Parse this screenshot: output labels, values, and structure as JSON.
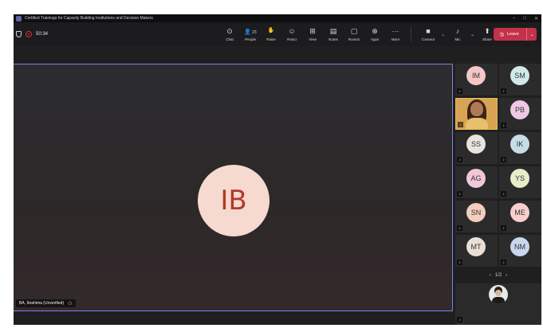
{
  "window": {
    "title": "Certified Trainings for Capacity Building Institutions and Decision Makers",
    "controls": [
      "–",
      "□",
      "✕"
    ]
  },
  "toolbar": {
    "timer": "50:34",
    "buttons": [
      {
        "id": "chat",
        "label": "Chat",
        "icon": "chat-icon",
        "glyph": "⊙"
      },
      {
        "id": "people",
        "label": "People",
        "icon": "people-icon",
        "glyph": "👤",
        "count": "23"
      },
      {
        "id": "raise",
        "label": "Raise",
        "icon": "raise-hand-icon",
        "glyph": "✋"
      },
      {
        "id": "react",
        "label": "React",
        "icon": "react-icon",
        "glyph": "☺"
      },
      {
        "id": "view",
        "label": "View",
        "icon": "view-icon",
        "glyph": "⊞"
      },
      {
        "id": "notes",
        "label": "Notes",
        "icon": "notes-icon",
        "glyph": "▤"
      },
      {
        "id": "rooms",
        "label": "Rooms",
        "icon": "rooms-icon",
        "glyph": "▢"
      },
      {
        "id": "apps",
        "label": "Apps",
        "icon": "apps-icon",
        "glyph": "⊕"
      },
      {
        "id": "more",
        "label": "More",
        "icon": "more-icon",
        "glyph": "···"
      }
    ],
    "camera_label": "Camera",
    "mic_label": "Mic",
    "share_label": "Share",
    "leave_label": "Leave",
    "leave_color": "#c4314b"
  },
  "stage": {
    "speaker_initials": "IB",
    "speaker_name": "BA, Ibrahima (Unverified)",
    "active_border_color": "#7b83eb"
  },
  "gallery": {
    "tiles": [
      {
        "initials": "IM",
        "bg": "#f3c7c7"
      },
      {
        "initials": "SM",
        "bg": "#cfe9ea"
      },
      {
        "initials": "",
        "video": true
      },
      {
        "initials": "PB",
        "bg": "#efc9e3"
      },
      {
        "initials": "SS",
        "bg": "#e7e3df"
      },
      {
        "initials": "IK",
        "bg": "#c7dbe8"
      },
      {
        "initials": "AG",
        "bg": "#f0c7d9"
      },
      {
        "initials": "YS",
        "bg": "#e7edc9"
      },
      {
        "initials": "SN",
        "bg": "#f5cdbd"
      },
      {
        "initials": "ME",
        "bg": "#f6cfcd"
      },
      {
        "initials": "MT",
        "bg": "#e9dfd6"
      },
      {
        "initials": "NM",
        "bg": "#c9d6ef"
      }
    ],
    "pager": "1/2"
  }
}
